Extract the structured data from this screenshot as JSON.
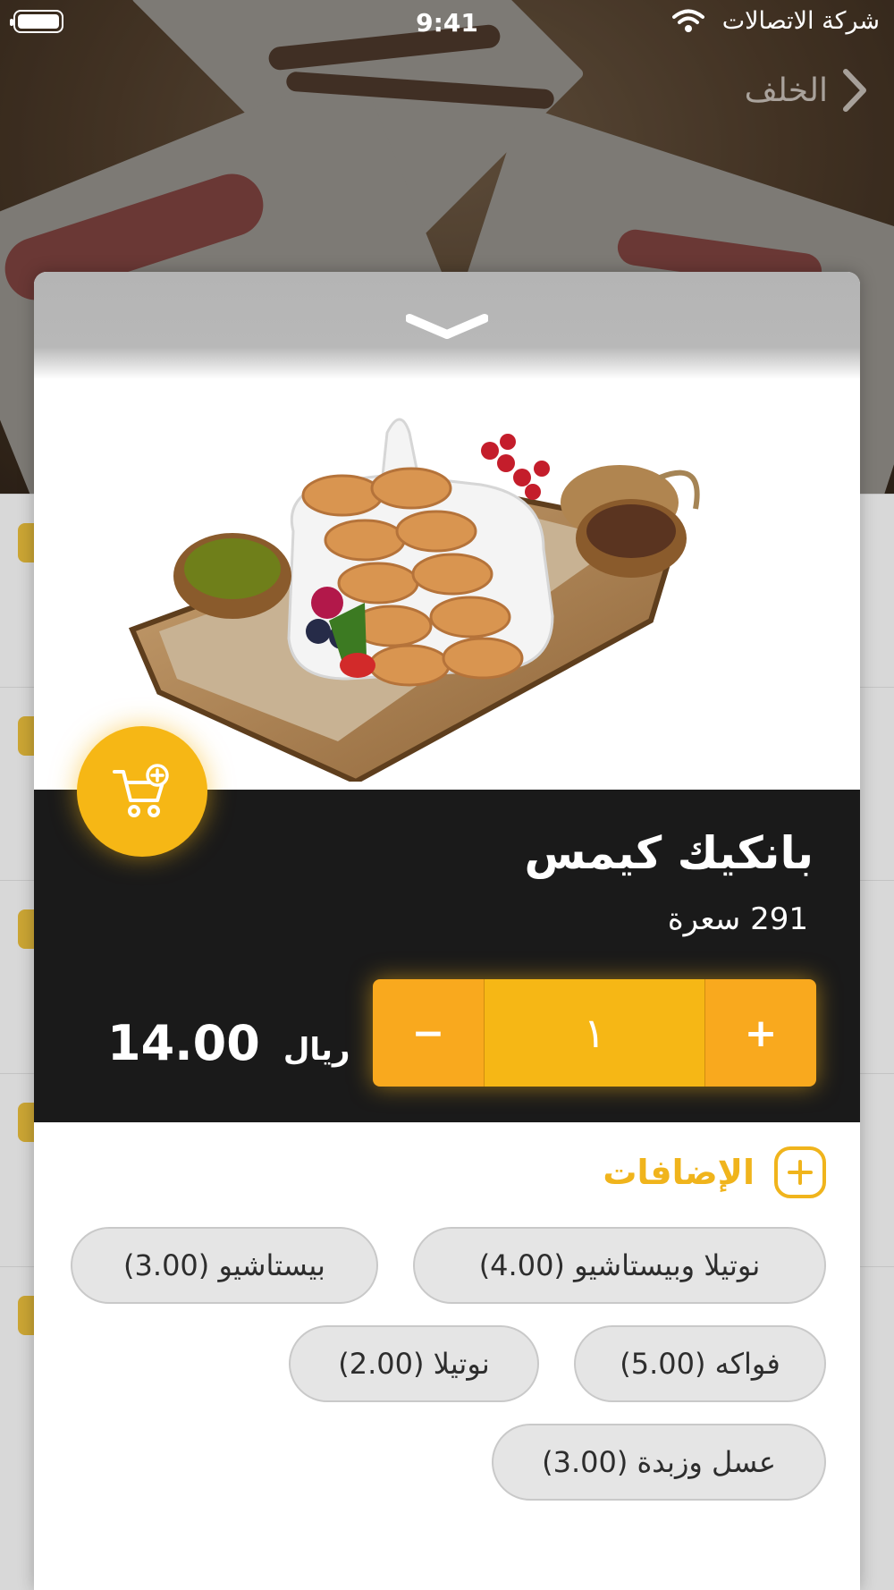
{
  "status_bar": {
    "time": "9:41",
    "carrier": "شركة الاتصالات"
  },
  "nav": {
    "back_label": "الخلف"
  },
  "product": {
    "name": "بانكيك كيمس",
    "ratings_text": "291 سعرة",
    "quantity": "١",
    "price": "14.00",
    "currency": "ريال"
  },
  "stepper": {
    "plus_label": "+",
    "minus_label": "−"
  },
  "addons": {
    "heading": "الإضافات",
    "items": [
      {
        "label": "نوتيلا وبيستاشيو (4.00)"
      },
      {
        "label": "بيستاشيو (3.00)"
      },
      {
        "label": "فواكه (5.00)"
      },
      {
        "label": "نوتيلا (2.00)"
      },
      {
        "label": "عسل وزبدة (3.00)"
      }
    ]
  },
  "colors": {
    "accent": "#f6b715",
    "dark_panel": "#1a1a1a",
    "chip_bg": "#e5e5e5"
  },
  "icons": [
    "battery-icon",
    "wifi-icon",
    "back-chevron-icon",
    "collapse-chevron-icon",
    "add-to-cart-icon",
    "add-circle-icon"
  ]
}
